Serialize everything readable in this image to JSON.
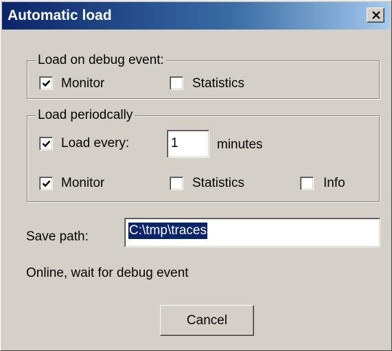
{
  "window": {
    "title": "Automatic load",
    "close_icon": "close-icon"
  },
  "debug_group": {
    "legend": "Load on debug event:",
    "monitor": {
      "label": "Monitor",
      "checked": true
    },
    "statistics": {
      "label": "Statistics",
      "checked": false
    }
  },
  "periodic_group": {
    "legend": "Load periodcally",
    "load_every": {
      "label": "Load every:",
      "checked": true
    },
    "minutes_value": "1",
    "minutes_label": "minutes",
    "monitor": {
      "label": "Monitor",
      "checked": true
    },
    "statistics": {
      "label": "Statistics",
      "checked": false
    },
    "info": {
      "label": "Info",
      "checked": false
    }
  },
  "save_path": {
    "label": "Save path:",
    "value": "C:\\tmp\\traces"
  },
  "status_text": "Online, wait for debug event",
  "cancel_button": {
    "label": "Cancel"
  }
}
